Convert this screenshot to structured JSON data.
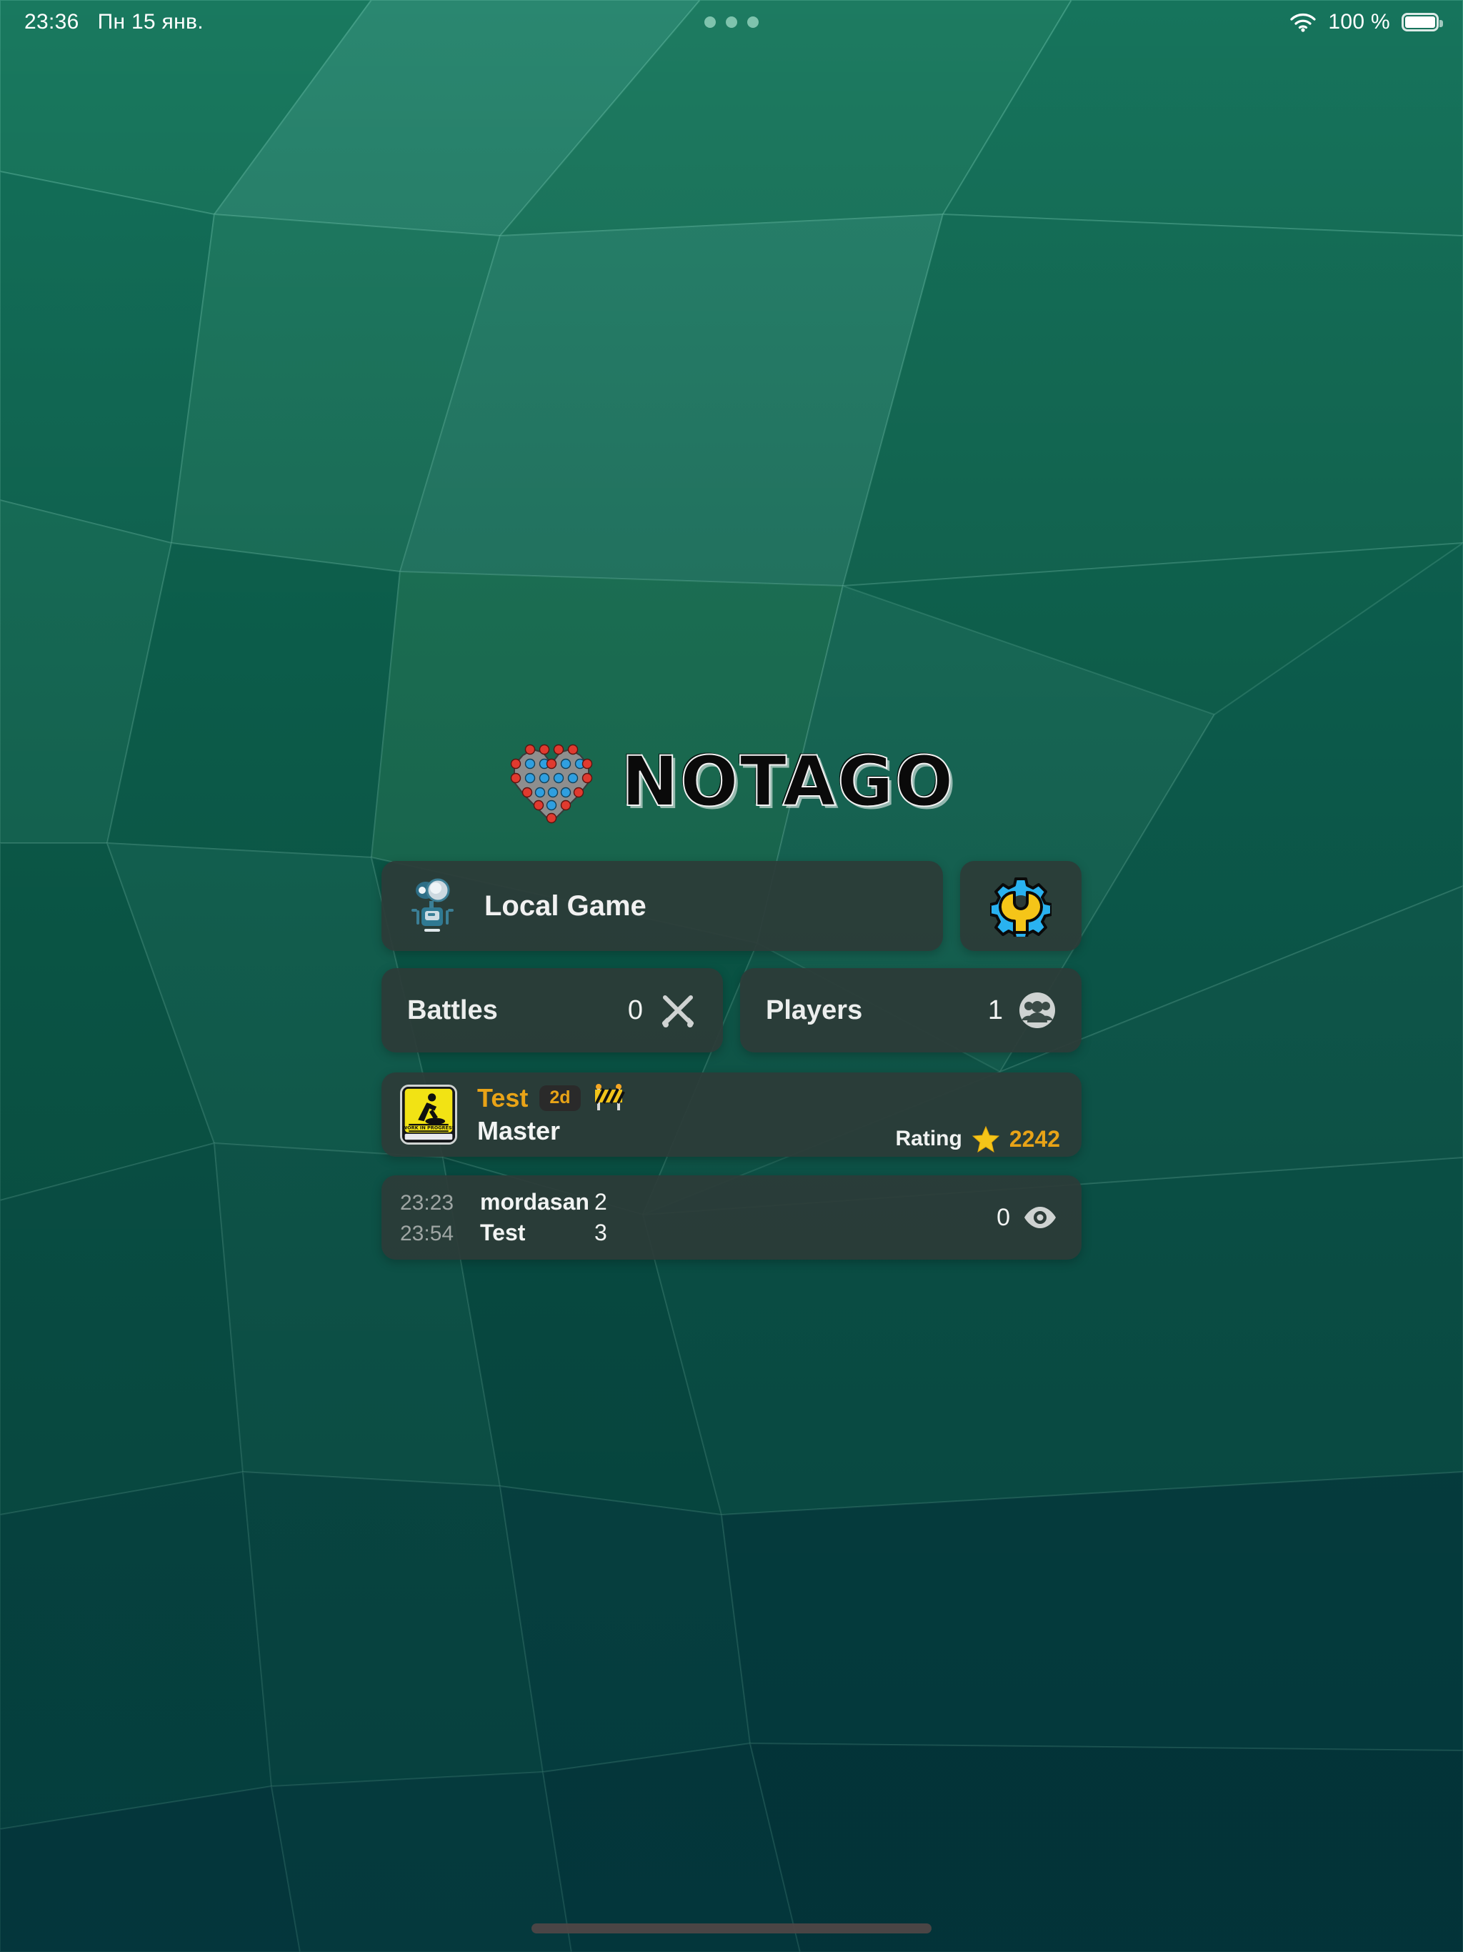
{
  "status_bar": {
    "time": "23:36",
    "date": "Пн 15 янв.",
    "battery_percent": "100 %",
    "wifi_icon": "wifi-icon",
    "battery_icon": "battery-full-icon",
    "multitask_handle_icon": "three-dots-handle-icon"
  },
  "brand": {
    "title": "NOTAGO",
    "logo_icon": "heart-dots-logo-icon"
  },
  "menu": {
    "local_game_label": "Local Game",
    "local_game_icon": "robot-icon",
    "settings_icon": "gear-wrench-icon"
  },
  "stats": [
    {
      "label": "Battles",
      "value": "0",
      "icon": "crossed-swords-icon"
    },
    {
      "label": "Players",
      "value": "1",
      "icon": "people-group-icon"
    }
  ],
  "profile": {
    "name": "Test",
    "age_badge": "2d",
    "status_icon": "construction-barrier-icon",
    "rank": "Master",
    "avatar_icon": "work-in-progress-sign-icon",
    "avatar_caption": "WORK IN PROGRESS",
    "rating_label": "Rating",
    "rating_icon": "star-icon",
    "rating_value": "2242"
  },
  "match": {
    "rows": [
      {
        "time": "23:23",
        "player": "mordasan",
        "score": "2"
      },
      {
        "time": "23:54",
        "player": "Test",
        "score": "3"
      }
    ],
    "spectators": "0",
    "spectators_icon": "eye-icon"
  },
  "colors": {
    "background_light": "#2a8770",
    "background_dark": "#0a4a4e",
    "card": "#2c3b38",
    "accent_gold": "#e8a317",
    "text_primary": "#f2f4f3",
    "text_muted": "#9fa6a4"
  }
}
